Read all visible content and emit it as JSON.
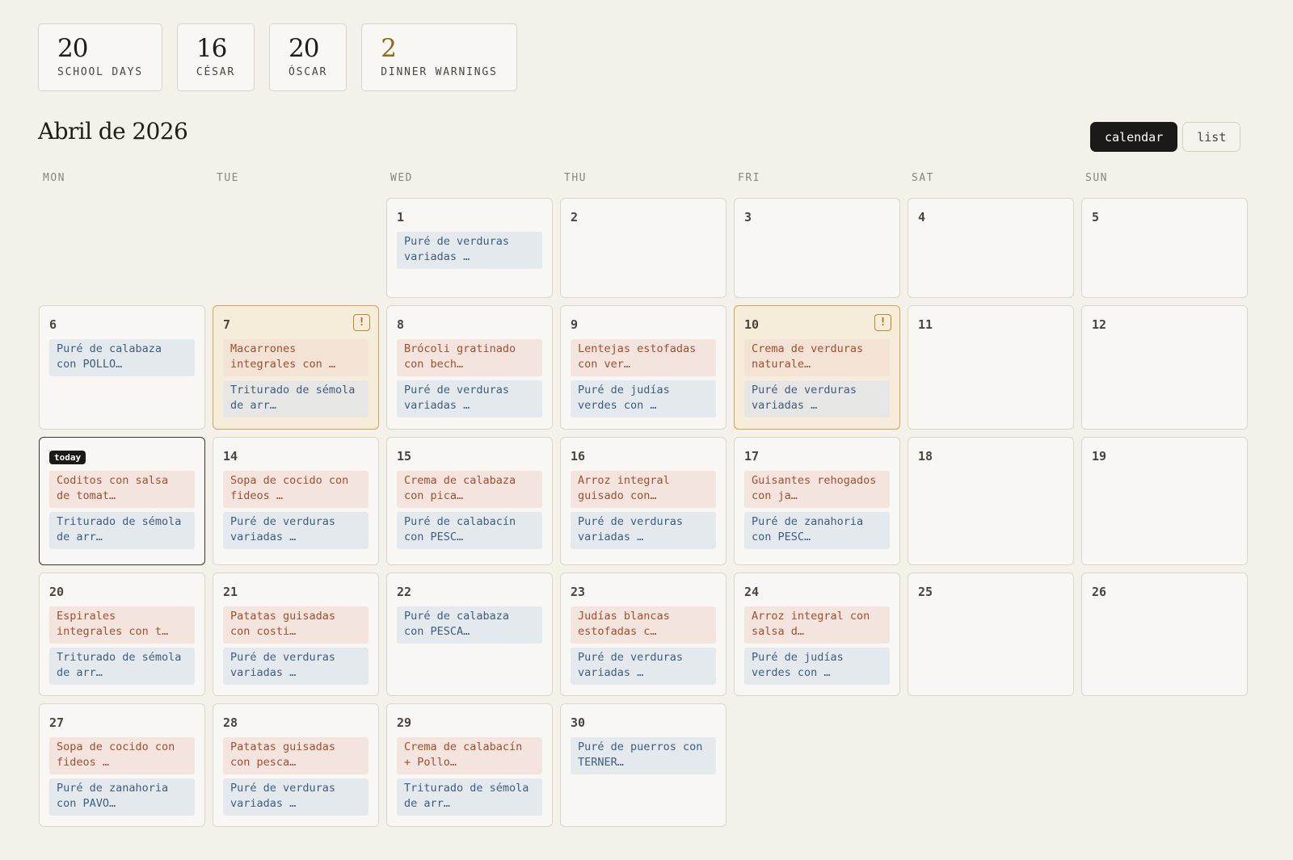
{
  "stats": [
    {
      "value": "20",
      "label": "SCHOOL DAYS"
    },
    {
      "value": "16",
      "label": "CÉSAR"
    },
    {
      "value": "20",
      "label": "ÓSCAR"
    },
    {
      "value": "2",
      "label": "DINNER WARNINGS"
    }
  ],
  "month_title": "Abril de 2026",
  "view_toggle": {
    "calendar": "calendar",
    "list": "list",
    "active": "calendar"
  },
  "weekdays": [
    "MON",
    "TUE",
    "WED",
    "THU",
    "FRI",
    "SAT",
    "SUN"
  ],
  "today_label": "today",
  "warning_symbol": "!",
  "colors": {
    "background": "#f4f1eb",
    "lunch_text": "#a14f2e",
    "lunch_bg": "#f3e5de",
    "dinner_text": "#3f5d7c",
    "dinner_bg": "#e4e9ee",
    "warning_bg": "#f5ecd9",
    "warning_border": "#c9a65a"
  },
  "days": [
    {
      "day": "1",
      "meals": [
        {
          "type": "dinner",
          "text": "Puré de verduras variadas …"
        }
      ]
    },
    {
      "day": "2",
      "meals": []
    },
    {
      "day": "3",
      "meals": []
    },
    {
      "day": "4",
      "meals": []
    },
    {
      "day": "5",
      "meals": []
    },
    {
      "day": "6",
      "meals": [
        {
          "type": "dinner",
          "text": "Puré de calabaza con POLLO…"
        }
      ]
    },
    {
      "day": "7",
      "warning": true,
      "meals": [
        {
          "type": "lunch",
          "text": "Macarrones integrales con …"
        },
        {
          "type": "dinner",
          "text": "Triturado de sémola de arr…"
        }
      ]
    },
    {
      "day": "8",
      "meals": [
        {
          "type": "lunch",
          "text": "Brócoli gratinado con bech…"
        },
        {
          "type": "dinner",
          "text": "Puré de verduras variadas …"
        }
      ]
    },
    {
      "day": "9",
      "meals": [
        {
          "type": "lunch",
          "text": "Lentejas estofadas con ver…"
        },
        {
          "type": "dinner",
          "text": "Puré de judías verdes con …"
        }
      ]
    },
    {
      "day": "10",
      "warning": true,
      "meals": [
        {
          "type": "lunch",
          "text": "Crema de verduras naturale…"
        },
        {
          "type": "dinner",
          "text": "Puré de verduras variadas …"
        }
      ]
    },
    {
      "day": "11",
      "meals": []
    },
    {
      "day": "12",
      "meals": []
    },
    {
      "day": "13",
      "today": true,
      "meals": [
        {
          "type": "lunch",
          "text": "Coditos con salsa de tomat…"
        },
        {
          "type": "dinner",
          "text": "Triturado de sémola de arr…"
        }
      ]
    },
    {
      "day": "14",
      "meals": [
        {
          "type": "lunch",
          "text": "Sopa de cocido con fideos …"
        },
        {
          "type": "dinner",
          "text": "Puré de verduras variadas …"
        }
      ]
    },
    {
      "day": "15",
      "meals": [
        {
          "type": "lunch",
          "text": "Crema de calabaza con pica…"
        },
        {
          "type": "dinner",
          "text": "Puré de calabacín con PESC…"
        }
      ]
    },
    {
      "day": "16",
      "meals": [
        {
          "type": "lunch",
          "text": "Arroz integral guisado con…"
        },
        {
          "type": "dinner",
          "text": "Puré de verduras variadas …"
        }
      ]
    },
    {
      "day": "17",
      "meals": [
        {
          "type": "lunch",
          "text": "Guisantes rehogados con ja…"
        },
        {
          "type": "dinner",
          "text": "Puré de zanahoria con PESC…"
        }
      ]
    },
    {
      "day": "18",
      "meals": []
    },
    {
      "day": "19",
      "meals": []
    },
    {
      "day": "20",
      "meals": [
        {
          "type": "lunch",
          "text": "Espirales integrales con t…"
        },
        {
          "type": "dinner",
          "text": "Triturado de sémola de arr…"
        }
      ]
    },
    {
      "day": "21",
      "meals": [
        {
          "type": "lunch",
          "text": "Patatas guisadas con costi…"
        },
        {
          "type": "dinner",
          "text": "Puré de verduras variadas …"
        }
      ]
    },
    {
      "day": "22",
      "meals": [
        {
          "type": "dinner",
          "text": "Puré de calabaza con PESCA…"
        }
      ]
    },
    {
      "day": "23",
      "meals": [
        {
          "type": "lunch",
          "text": "Judías blancas estofadas c…"
        },
        {
          "type": "dinner",
          "text": "Puré de verduras variadas …"
        }
      ]
    },
    {
      "day": "24",
      "meals": [
        {
          "type": "lunch",
          "text": "Arroz integral con salsa d…"
        },
        {
          "type": "dinner",
          "text": "Puré de judías verdes con …"
        }
      ]
    },
    {
      "day": "25",
      "meals": []
    },
    {
      "day": "26",
      "meals": []
    },
    {
      "day": "27",
      "meals": [
        {
          "type": "lunch",
          "text": "Sopa de cocido con fideos …"
        },
        {
          "type": "dinner",
          "text": "Puré de zanahoria con PAVO…"
        }
      ]
    },
    {
      "day": "28",
      "meals": [
        {
          "type": "lunch",
          "text": "Patatas guisadas con pesca…"
        },
        {
          "type": "dinner",
          "text": "Puré de verduras variadas …"
        }
      ]
    },
    {
      "day": "29",
      "meals": [
        {
          "type": "lunch",
          "text": "Crema de calabacín + Pollo…"
        },
        {
          "type": "dinner",
          "text": "Triturado de sémola de arr…"
        }
      ]
    },
    {
      "day": "30",
      "meals": [
        {
          "type": "dinner",
          "text": "Puré de puerros con TERNER…"
        }
      ]
    }
  ]
}
